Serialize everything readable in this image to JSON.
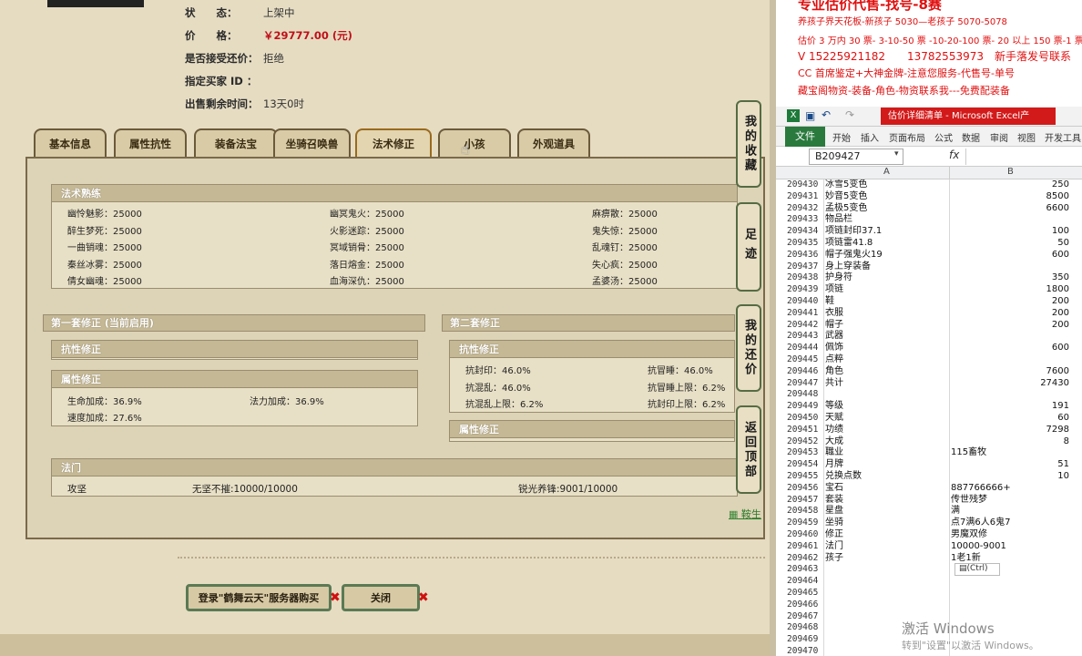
{
  "info": {
    "status_label": "状　　态：",
    "status_value": "上架中",
    "price_label": "价　　格：",
    "price_value": "￥29777.00 (元)",
    "bargain_label": "是否接受还价：",
    "bargain_value": "拒绝",
    "buyer_label": "指定买家 ID ：",
    "buyer_value": "",
    "time_label": "出售剩余时间：",
    "time_value": "13天0时"
  },
  "tabs": [
    "基本信息",
    "属性抗性",
    "装备法宝",
    "坐骑召唤兽",
    "法术修正",
    "小孩",
    "外观道具"
  ],
  "spell_section": {
    "title": "法术熟练",
    "skills": [
      [
        "幽怜魅影：25000",
        "幽冥鬼火：25000",
        "麻痹散：25000"
      ],
      [
        "醉生梦死：25000",
        "火影迷踪：25000",
        "鬼失惊：25000"
      ],
      [
        "一曲销魂：25000",
        "冥域销骨：25000",
        "乱魂钉：25000"
      ],
      [
        "秦丝冰雾：25000",
        "落日熔金：25000",
        "失心疯：25000"
      ],
      [
        "倩女幽魂：25000",
        "血海深仇：25000",
        "孟婆汤：25000"
      ]
    ]
  },
  "set1": {
    "title": "第一套修正 (当前启用)",
    "resist_title": "抗性修正",
    "attr_title": "属性修正",
    "attr": [
      "生命加成：36.9%",
      "法力加成：36.9%",
      "速度加成：27.6%"
    ]
  },
  "set2": {
    "title": "第二套修正",
    "resist_title": "抗性修正",
    "resist": [
      "抗封印：46.0%",
      "抗冒睡：46.0%",
      "抗混乱：46.0%",
      "抗冒睡上限：6.2%",
      "抗混乱上限：6.2%",
      "抗封印上限：6.2%"
    ],
    "attr_title": "属性修正"
  },
  "fa_men": {
    "title": "法门",
    "items": [
      "攻坚",
      "无坚不摧:10000/10000",
      "锐光养锋:9001/10000"
    ]
  },
  "side_buttons": [
    "我的收藏",
    "足迹",
    "我的还价",
    "返回顶部"
  ],
  "side_link": "鞍生",
  "buttons": {
    "login": "登录\"鹤舞云天\"服务器购买",
    "close": "关闭"
  },
  "ad": {
    "line0": "专业估价代售-找号-8赛",
    "line1": "养孩子界天花板-新孩子 5030—老孩子 5070-5078",
    "line2": "估价 3 万内 30 票- 3-10-50 票 -10-20-100 票- 20 以上 150 票-1 票 1",
    "line3": "V 15225921182　　13782553973　新手落发号联系",
    "line4": "CC 首席鉴定+大神金牌-注意您服务-代售号-单号",
    "line5": "藏宝阁物资-装备-角色-物资联系我---免费配装备"
  },
  "excel": {
    "title": "估价详细清单 - Microsoft Excel产",
    "file_tab": "文件",
    "ribbon": [
      "开始",
      "插入",
      "页面布局",
      "公式",
      "数据",
      "审阅",
      "视图",
      "开发工具"
    ],
    "namebox": "B209427",
    "fx": "fx",
    "col_a": "A",
    "col_b": "B",
    "rows": [
      [
        "209430",
        "冰雪5变色",
        "250"
      ],
      [
        "209431",
        "妙音5变色",
        "8500"
      ],
      [
        "209432",
        "孟极5变色",
        "6600"
      ],
      [
        "209433",
        "物品栏",
        ""
      ],
      [
        "209434",
        "项链封印37.1",
        "100"
      ],
      [
        "209435",
        "项链雷41.8",
        "50"
      ],
      [
        "209436",
        "帽子强鬼火19",
        "600"
      ],
      [
        "209437",
        "身上穿装备",
        ""
      ],
      [
        "209438",
        "护身符",
        "350"
      ],
      [
        "209439",
        "项链",
        "1800"
      ],
      [
        "209440",
        "鞋",
        "200"
      ],
      [
        "209441",
        "衣服",
        "200"
      ],
      [
        "209442",
        "帽子",
        "200"
      ],
      [
        "209443",
        "武器",
        ""
      ],
      [
        "209444",
        "佩饰",
        "600"
      ],
      [
        "209445",
        "点粹",
        ""
      ],
      [
        "209446",
        "角色",
        "7600"
      ],
      [
        "209447",
        "共计",
        "27430"
      ],
      [
        "209448",
        "",
        ""
      ],
      [
        "209449",
        "等级",
        "191"
      ],
      [
        "209450",
        "天赋",
        "60"
      ],
      [
        "209451",
        "功绩",
        "7298"
      ],
      [
        "209452",
        "大成",
        "8"
      ],
      [
        "209453",
        "職业",
        "115畜牧"
      ],
      [
        "209454",
        "月牌",
        "51"
      ],
      [
        "209455",
        "兑换点数",
        "10"
      ],
      [
        "209456",
        "宝石",
        "887766666+"
      ],
      [
        "209457",
        "套装",
        "传世残梦"
      ],
      [
        "209458",
        "星盘",
        "满"
      ],
      [
        "209459",
        "坐骑",
        "点7满6人6鬼7"
      ],
      [
        "209460",
        "修正",
        "男魔双修"
      ],
      [
        "209461",
        "法门",
        "10000-9001"
      ],
      [
        "209462",
        "孩子",
        "1老1新"
      ],
      [
        "209463",
        "",
        ""
      ],
      [
        "209464",
        "",
        ""
      ],
      [
        "209465",
        "",
        ""
      ],
      [
        "209466",
        "",
        ""
      ],
      [
        "209467",
        "",
        ""
      ],
      [
        "209468",
        "",
        ""
      ],
      [
        "209469",
        "",
        ""
      ],
      [
        "209470",
        "",
        ""
      ],
      [
        "209471",
        "",
        ""
      ]
    ],
    "paste_hint": "(Ctrl)",
    "watermark": "激活 Windows",
    "watermark_sub": "转到\"设置\"以激活 Windows。"
  }
}
